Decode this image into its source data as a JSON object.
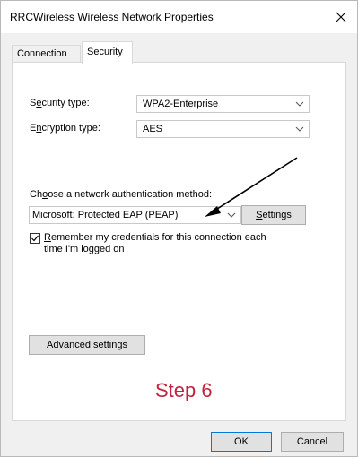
{
  "window": {
    "title": "RRCWireless Wireless Network Properties"
  },
  "tabs": [
    {
      "label": "Connection"
    },
    {
      "label": "Security"
    }
  ],
  "security_type": {
    "label_pre": "S",
    "label_ul": "e",
    "label_post": "curity type:",
    "value": "WPA2-Enterprise"
  },
  "encryption_type": {
    "label_pre": "E",
    "label_ul": "n",
    "label_post": "cryption type:",
    "value": "AES"
  },
  "auth_method": {
    "label_pre": "Ch",
    "label_ul": "o",
    "label_post": "ose a network authentication method:",
    "value": "Microsoft: Protected EAP (PEAP)",
    "settings_ul": "S",
    "settings_post": "ettings"
  },
  "remember": {
    "checked": true,
    "line1_ul": "R",
    "line1_post": "emember my credentials for this connection each",
    "line2": "time I'm logged on"
  },
  "advanced": {
    "pre": "A",
    "ul": "d",
    "post": "vanced settings"
  },
  "annotation": {
    "step_text": "Step 6",
    "color": "#c0253f"
  },
  "footer": {
    "ok_label": "OK",
    "cancel_label": "Cancel"
  },
  "icons": {
    "close": "close-icon",
    "chevron": "chevron-down-icon",
    "arrow": "annotation-arrow"
  }
}
